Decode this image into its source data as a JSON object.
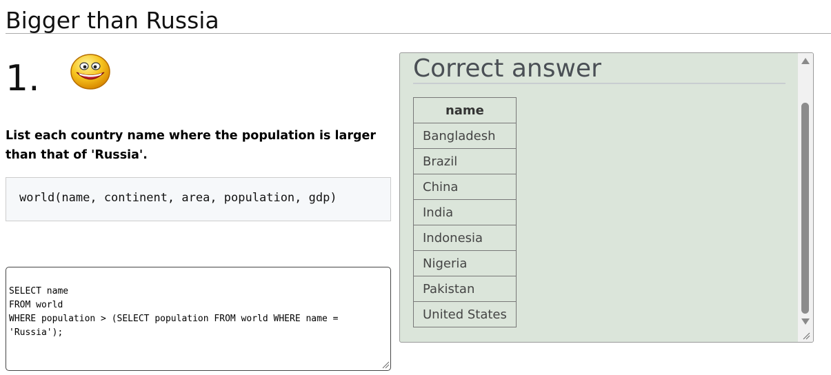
{
  "page": {
    "title": "Bigger than Russia"
  },
  "question": {
    "number": "1.",
    "icon": "smiley-face-icon",
    "text": "List each country name where the population is larger than that of 'Russia'.",
    "schema": "world(name, continent, area, population, gdp)"
  },
  "editor": {
    "sql": "SELECT name\nFROM world\nWHERE population > (SELECT population FROM world WHERE name =\n'Russia');"
  },
  "answer": {
    "heading": "Correct answer",
    "columns": [
      "name"
    ],
    "rows": [
      "Bangladesh",
      "Brazil",
      "China",
      "India",
      "Indonesia",
      "Nigeria",
      "Pakistan",
      "United States"
    ]
  },
  "colors": {
    "panel_bg": "#dbe5da",
    "schema_bg": "#f6f8fa"
  }
}
